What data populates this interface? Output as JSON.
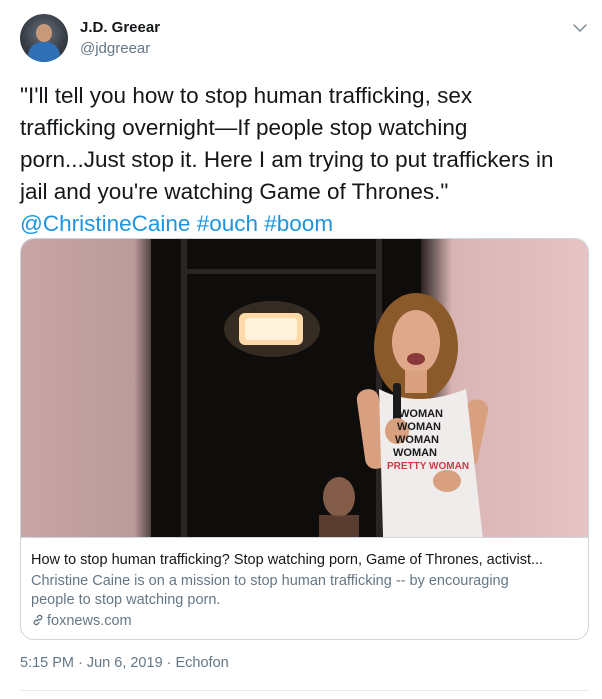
{
  "author": {
    "name": "J.D. Greear",
    "handle": "@jdgreear"
  },
  "tweet": {
    "lines": [
      "\"I'll tell you how to stop human trafficking, sex",
      "trafficking overnight—If people stop watching",
      "porn...Just stop it. Here I am trying to put traffickers in",
      "jail and you're watching Game of Thrones.\""
    ],
    "mention": "@ChristineCaine",
    "hashtags": [
      "#ouch",
      "#boom"
    ]
  },
  "card": {
    "title": "How to stop human trafficking? Stop watching porn, Game of Thrones, activist...",
    "description_lines": [
      "Christine Caine is on a mission to stop human trafficking -- by encouraging",
      "people to stop watching porn."
    ],
    "domain": "foxnews.com",
    "shirt_text": [
      "WOMAN",
      "WOMAN",
      "WOMAN",
      "WOMAN",
      "PRETTY WOMAN"
    ]
  },
  "meta": {
    "time": "5:15 PM",
    "date": "Jun 6, 2019",
    "client": "Echofon",
    "separator": "·"
  },
  "colors": {
    "link": "#1b95e0",
    "secondary_text": "#657786",
    "border": "#ccd6dd"
  },
  "icons": {
    "caret": "chevron-down-icon",
    "card_link": "link-icon"
  }
}
